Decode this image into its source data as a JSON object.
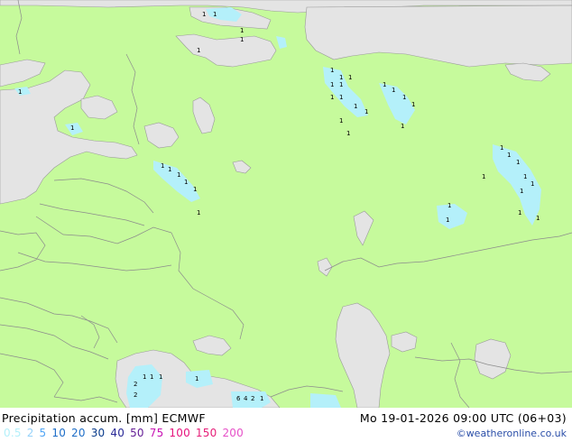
{
  "footer": {
    "title": "Precipitation accum. [mm] ECMWF",
    "datetime": "Mo 19-01-2026 09:00 UTC (06+03)",
    "credit": "©weatheronline.co.uk",
    "legend": [
      {
        "label": "0.5",
        "color": "#b4f0fa"
      },
      {
        "label": "2",
        "color": "#96d2fa"
      },
      {
        "label": "5",
        "color": "#50a5f5"
      },
      {
        "label": "10",
        "color": "#1e6ec8"
      },
      {
        "label": "20",
        "color": "#1e6ec8"
      },
      {
        "label": "30",
        "color": "#0a3c8c"
      },
      {
        "label": "40",
        "color": "#282896"
      },
      {
        "label": "50",
        "color": "#641e96"
      },
      {
        "label": "75",
        "color": "#c814b4"
      },
      {
        "label": "100",
        "color": "#e6147d"
      },
      {
        "label": "150",
        "color": "#e61e78"
      },
      {
        "label": "200",
        "color": "#e650c8"
      }
    ]
  },
  "colors": {
    "land": "#c6fa9c",
    "water": "#e4e4e4",
    "border": "#8c8c8c",
    "precip_light": "#b4f0fa"
  },
  "labels": [
    {
      "text": "1"
    },
    {
      "text": "1"
    },
    {
      "text": "1"
    },
    {
      "text": "1"
    },
    {
      "text": "1"
    },
    {
      "text": "1"
    },
    {
      "text": "1"
    },
    {
      "text": "1"
    },
    {
      "text": "1"
    },
    {
      "text": "1"
    },
    {
      "text": "1"
    },
    {
      "text": "1"
    },
    {
      "text": "1"
    },
    {
      "text": "1"
    },
    {
      "text": "1"
    },
    {
      "text": "1"
    },
    {
      "text": "1"
    },
    {
      "text": "1"
    },
    {
      "text": "1"
    },
    {
      "text": "1"
    },
    {
      "text": "1"
    },
    {
      "text": "1"
    },
    {
      "text": "1"
    },
    {
      "text": "1"
    },
    {
      "text": "1"
    },
    {
      "text": "1"
    },
    {
      "text": "1"
    },
    {
      "text": "1"
    },
    {
      "text": "1"
    },
    {
      "text": "1"
    },
    {
      "text": "1"
    },
    {
      "text": "1"
    },
    {
      "text": "1"
    },
    {
      "text": "1"
    },
    {
      "text": "1"
    },
    {
      "text": "1"
    },
    {
      "text": "1"
    },
    {
      "text": "1"
    },
    {
      "text": "1"
    },
    {
      "text": "1"
    },
    {
      "text": "2"
    },
    {
      "text": "1"
    },
    {
      "text": "1"
    },
    {
      "text": "1"
    },
    {
      "text": "6"
    },
    {
      "text": "4"
    },
    {
      "text": "2"
    },
    {
      "text": "1"
    },
    {
      "text": "2"
    },
    {
      "text": "1"
    }
  ]
}
